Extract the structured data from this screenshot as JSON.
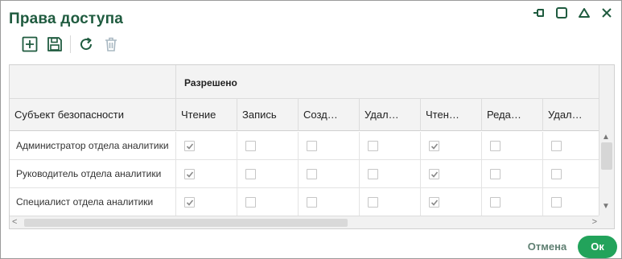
{
  "dialog": {
    "title": "Права доступа"
  },
  "window_controls": [
    {
      "icon": "pin-icon"
    },
    {
      "icon": "maximize-icon"
    },
    {
      "icon": "collapse-icon"
    },
    {
      "icon": "close-icon"
    }
  ],
  "toolbar": [
    {
      "icon": "add-icon",
      "enabled": true
    },
    {
      "icon": "save-icon",
      "enabled": true
    },
    {
      "icon": "refresh-icon",
      "enabled": true
    },
    {
      "icon": "delete-icon",
      "enabled": false
    }
  ],
  "grid": {
    "group_header": "Разрешено",
    "subject_header": "Субъект безопасности",
    "columns": [
      "Чтение",
      "Запись",
      "Созд…",
      "Удал…",
      "Чтен…",
      "Реда…",
      "Удал…"
    ],
    "rows": [
      {
        "subject": "Администратор отдела аналитики",
        "checks": [
          true,
          false,
          false,
          false,
          true,
          false,
          false
        ]
      },
      {
        "subject": "Руководитель отдела аналитики",
        "checks": [
          true,
          false,
          false,
          false,
          true,
          false,
          false
        ]
      },
      {
        "subject": "Специалист отдела аналитики",
        "checks": [
          true,
          false,
          false,
          false,
          true,
          false,
          false
        ]
      }
    ]
  },
  "scrollbars": {
    "up": "▲",
    "down": "▼",
    "left": "<",
    "right": ">"
  },
  "footer": {
    "cancel_label": "Отмена",
    "ok_label": "Ок"
  },
  "colors": {
    "title": "#1f5b3f",
    "ok_button": "#22a35b",
    "cancel_text": "#5f7f72",
    "header_bg": "#f3f3f3"
  }
}
